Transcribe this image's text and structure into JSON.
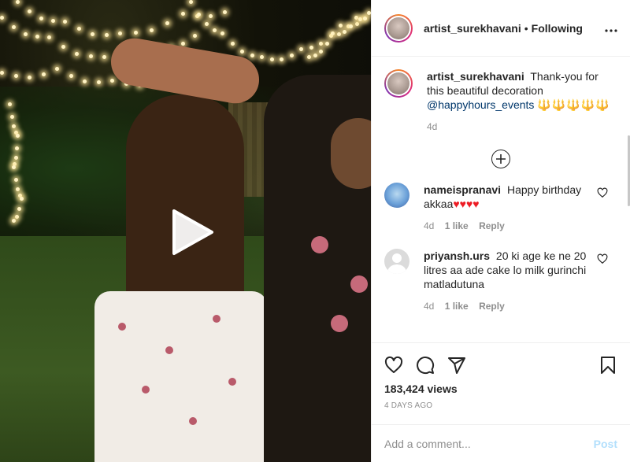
{
  "header": {
    "username": "artist_surekhavani",
    "separator": "•",
    "follow_status": "Following",
    "more_icon": "more-horizontal-icon"
  },
  "caption": {
    "username": "artist_surekhavani",
    "text": "Thank-you for this beautiful decoration",
    "mention": "@happyhours_events",
    "emoji": "🔱🔱🔱🔱🔱",
    "age": "4d"
  },
  "load_more_icon": "plus-circle-icon",
  "comments": [
    {
      "username": "nameispranavi",
      "text": "Happy birthday akkaa",
      "emoji": "♥♥♥♥",
      "age": "4d",
      "likes": "1 like",
      "reply": "Reply"
    },
    {
      "username": "priyansh.urs",
      "text": "20 ki age ke ne 20 litres aa ade cake lo milk gurinchi matladutuna",
      "age": "4d",
      "likes": "1 like",
      "reply": "Reply"
    }
  ],
  "actions": {
    "like_icon": "heart-icon",
    "comment_icon": "comment-icon",
    "share_icon": "send-icon",
    "save_icon": "bookmark-icon"
  },
  "stats": {
    "views": "183,424 views",
    "posted": "4 DAYS AGO"
  },
  "add_comment": {
    "placeholder": "Add a comment...",
    "post_label": "Post"
  },
  "media": {
    "play_icon": "play-icon"
  },
  "colors": {
    "mention": "#00376b",
    "muted": "#8e8e8e",
    "post_disabled": "#b2dffc",
    "hearts": "#ed1c24"
  }
}
